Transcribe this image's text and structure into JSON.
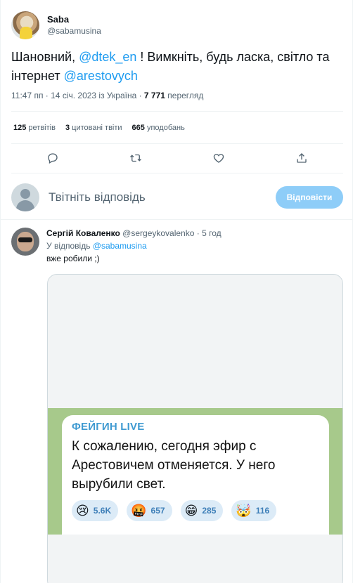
{
  "tweet": {
    "author": {
      "name": "Saba",
      "handle": "@sabamusina"
    },
    "text_parts": {
      "p1": "Шановний, ",
      "m1": "@dtek_en",
      "p2": " ! Вимкніть, будь ласка, світло та інтернет ",
      "m2": "@arestovych"
    },
    "meta": {
      "time_date": "11:47 пп · 14 січ. 2023 із Україна · ",
      "views_count": "7 771",
      "views_label": " перегляд"
    },
    "stats": {
      "retweets_count": "125",
      "retweets_label": "ретвітів",
      "quotes_count": "3",
      "quotes_label": "цитовані твіти",
      "likes_count": "665",
      "likes_label": "уподобань"
    },
    "actions": [
      "reply-icon",
      "retweet-icon",
      "like-icon",
      "share-icon"
    ]
  },
  "reply_compose": {
    "placeholder": "Твітніть відповідь",
    "button_label": "Відповісти"
  },
  "reply": {
    "name": "Сергій Коваленко",
    "handle": "@sergeykovalenko",
    "sep": " · ",
    "time": "5 год",
    "replying_prefix": "У відповідь ",
    "replying_to": "@sabamusina",
    "text": "вже робили ;)",
    "media": {
      "channel": "ФЕЙГИН LIVE",
      "message": "К сожалению, сегодня эфир с Арестовичем отменяется. У него вырубили свет.",
      "reactions": [
        {
          "emoji": "😢",
          "count": "5.6K"
        },
        {
          "emoji": "🤬",
          "count": "657"
        },
        {
          "emoji": "😁",
          "count": "285"
        },
        {
          "emoji": "🤯",
          "count": "116"
        }
      ]
    }
  },
  "colors": {
    "accent": "#1d9bf0",
    "muted": "#536471",
    "button_disabled": "#8ecdf8"
  }
}
